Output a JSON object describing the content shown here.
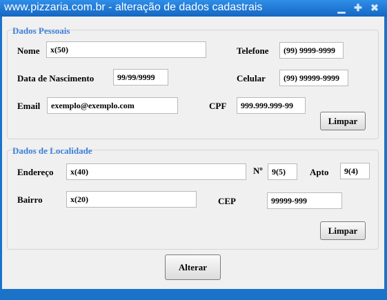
{
  "window": {
    "title": "www.pizzaria.com.br - alteração de dados cadastrais",
    "controls": {
      "minimize": "▁",
      "maximize": "✚",
      "close": "✖"
    }
  },
  "dados_pessoais": {
    "title": "Dados Pessoais",
    "nome": {
      "label": "Nome",
      "value": "x(50)"
    },
    "telefone": {
      "label": "Telefone",
      "value": "(99) 9999-9999"
    },
    "data_nascimento": {
      "label": "Data de Nascimento",
      "value": "99/99/9999"
    },
    "celular": {
      "label": "Celular",
      "value": "(99) 99999-9999"
    },
    "email": {
      "label": "Email",
      "value": "exemplo@exemplo.com"
    },
    "cpf": {
      "label": "CPF",
      "value": "999.999.999-99"
    },
    "limpar_label": "Limpar"
  },
  "dados_localidade": {
    "title": "Dados de Localidade",
    "endereco": {
      "label": "Endereço",
      "value": "x(40)"
    },
    "numero": {
      "label": "Nº",
      "value": "9(5)"
    },
    "apto": {
      "label": "Apto",
      "value": "9(4)"
    },
    "bairro": {
      "label": "Bairro",
      "value": "x(20)"
    },
    "cep": {
      "label": "CEP",
      "value": "99999-999"
    },
    "limpar_label": "Limpar"
  },
  "alterar_label": "Alterar",
  "colors": {
    "titlebar": "#1a73c9",
    "group_title": "#3b7fd8",
    "client_bg": "#f0f0f0"
  }
}
